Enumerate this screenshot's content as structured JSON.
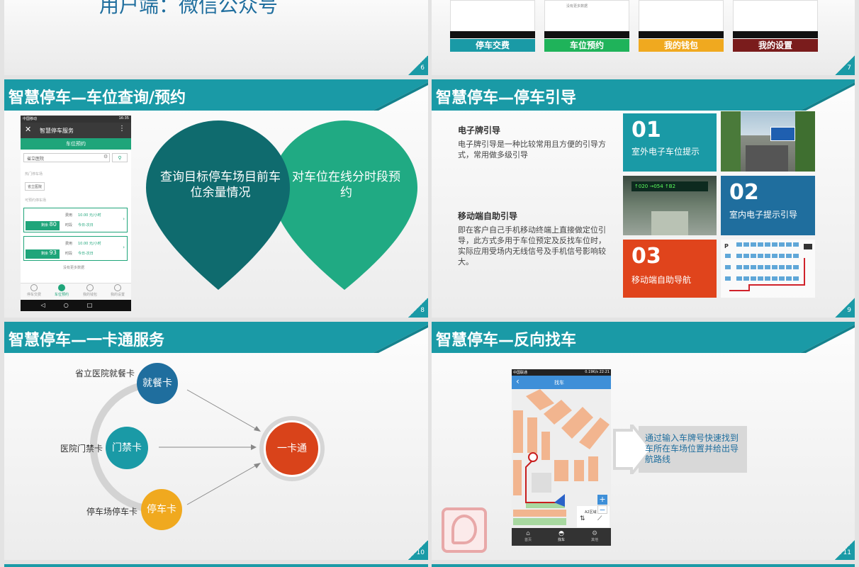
{
  "s6": {
    "heading": "用户端：微信公众号",
    "num": "6"
  },
  "s7": {
    "num": "7",
    "buttons": [
      {
        "label": "停车交费",
        "color": "#1a9aa6"
      },
      {
        "label": "车位预约",
        "color": "#1fb35a"
      },
      {
        "label": "我的钱包",
        "color": "#f0a91f"
      },
      {
        "label": "我的设置",
        "color": "#7a1c1c"
      }
    ],
    "strip_text": "没有更多数据"
  },
  "s8": {
    "title": "智慧停车—车位查询/预约",
    "num": "8",
    "drop1": "查询目标停车场目前车位余量情况",
    "drop2": "对车位在线分时段预约",
    "phone": {
      "status_left": "中国移动",
      "status_right": "16:35",
      "app_title": "智慧停车服务",
      "tab": "车位预约",
      "search_value": "省立医院",
      "section_hot": "热门停车场",
      "hot_tag": "省立医院",
      "section_list": "可预约停车场",
      "cards": [
        {
          "fee_label": "费用",
          "fee": "10.00 元/小时",
          "time_label": "时段",
          "time": "今日-次日",
          "remain_label": "剩余",
          "remain": "80"
        },
        {
          "fee_label": "费用",
          "fee": "10.00 元/小时",
          "time_label": "时段",
          "time": "今日-次日",
          "remain_label": "剩余",
          "remain": "93"
        }
      ],
      "no_more": "没有更多数据",
      "nav": [
        "停车交费",
        "车位预约",
        "我的钱包",
        "我的设置"
      ]
    }
  },
  "s9": {
    "title": "智慧停车—停车引导",
    "num": "9",
    "h1": "电子牌引导",
    "p1": "电子牌引导是一种比较常用且方便的引导方式，常用做多级引导",
    "h2": "移动端自助引导",
    "p2": "即在客户自己手机移动终端上直接做定位引导，此方式多用于车位预定及反找车位时，实际应用受场内无线信号及手机信号影响较大。",
    "tiles": [
      {
        "num": "01",
        "label": "室外电子车位提示",
        "color": "#1a9aa6"
      },
      {
        "num": "02",
        "label": "室内电子提示引导",
        "color": "#1f6e9e"
      },
      {
        "num": "03",
        "label": "移动端自助导航",
        "color": "#e0441c"
      }
    ],
    "sign_texts": [
      "↑020",
      "→054",
      "↑B2"
    ]
  },
  "s10": {
    "title": "智慧停车—一卡通服务",
    "num": "10",
    "cards": [
      {
        "label": "就餐卡",
        "desc": "省立医院就餐卡",
        "color": "#1f6e9e"
      },
      {
        "label": "门禁卡",
        "desc": "医院门禁卡",
        "color": "#1a9aa6"
      },
      {
        "label": "停车卡",
        "desc": "停车场停车卡",
        "color": "#f0a91f"
      }
    ],
    "center": "一卡通",
    "center_color": "#d9431a"
  },
  "s11": {
    "title": "智慧停车—反向找车",
    "num": "11",
    "phone": {
      "status_left": "中国联通",
      "status_right": "0.19K/s 22:21",
      "header": "找车",
      "zone": "A2区域",
      "nav": [
        "首页",
        "找车",
        "其他"
      ]
    },
    "callout": "通过输入车牌号快速找到车所在车场位置并给出导航路线"
  }
}
